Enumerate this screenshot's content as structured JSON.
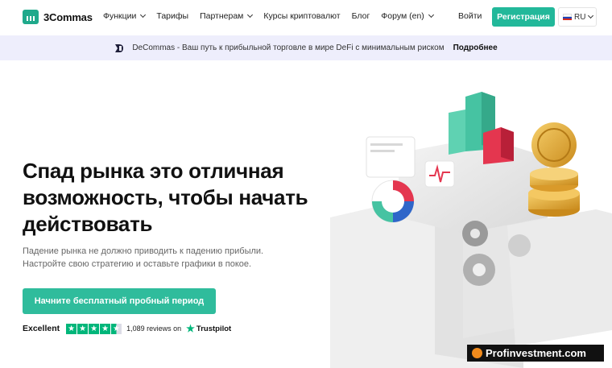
{
  "header": {
    "logo_text": "3Commas",
    "nav": [
      {
        "label": "Функции",
        "dropdown": true
      },
      {
        "label": "Тарифы",
        "dropdown": false
      },
      {
        "label": "Партнерам",
        "dropdown": true
      },
      {
        "label": "Курсы криптовалют",
        "dropdown": false
      },
      {
        "label": "Блог",
        "dropdown": false
      },
      {
        "label": "Форум (en)",
        "dropdown": true
      }
    ],
    "login_label": "Войти",
    "register_label": "Регистрация",
    "lang_label": "RU"
  },
  "banner": {
    "text": "DeCommas - Ваш путь к прибыльной торговле в мире DeFi с минимальным риском",
    "link_label": "Подробнее"
  },
  "hero": {
    "title": "Спад рынка это отличная возможность, чтобы начать действовать",
    "subtitle": "Падение рынка не должно приводить к падению прибыли. Настройте свою стратегию и оставьте графики в покое.",
    "cta_label": "Начните бесплатный пробный период"
  },
  "trustpilot": {
    "rating_label": "Excellent",
    "stars": 4.5,
    "reviews_text": "1,089 reviews on",
    "brand": "Trustpilot"
  },
  "watermark": {
    "text": "Profinvestment.com"
  },
  "colors": {
    "accent": "#22b89a",
    "banner_bg": "#eeeefc",
    "trustpilot_green": "#00b67a"
  }
}
